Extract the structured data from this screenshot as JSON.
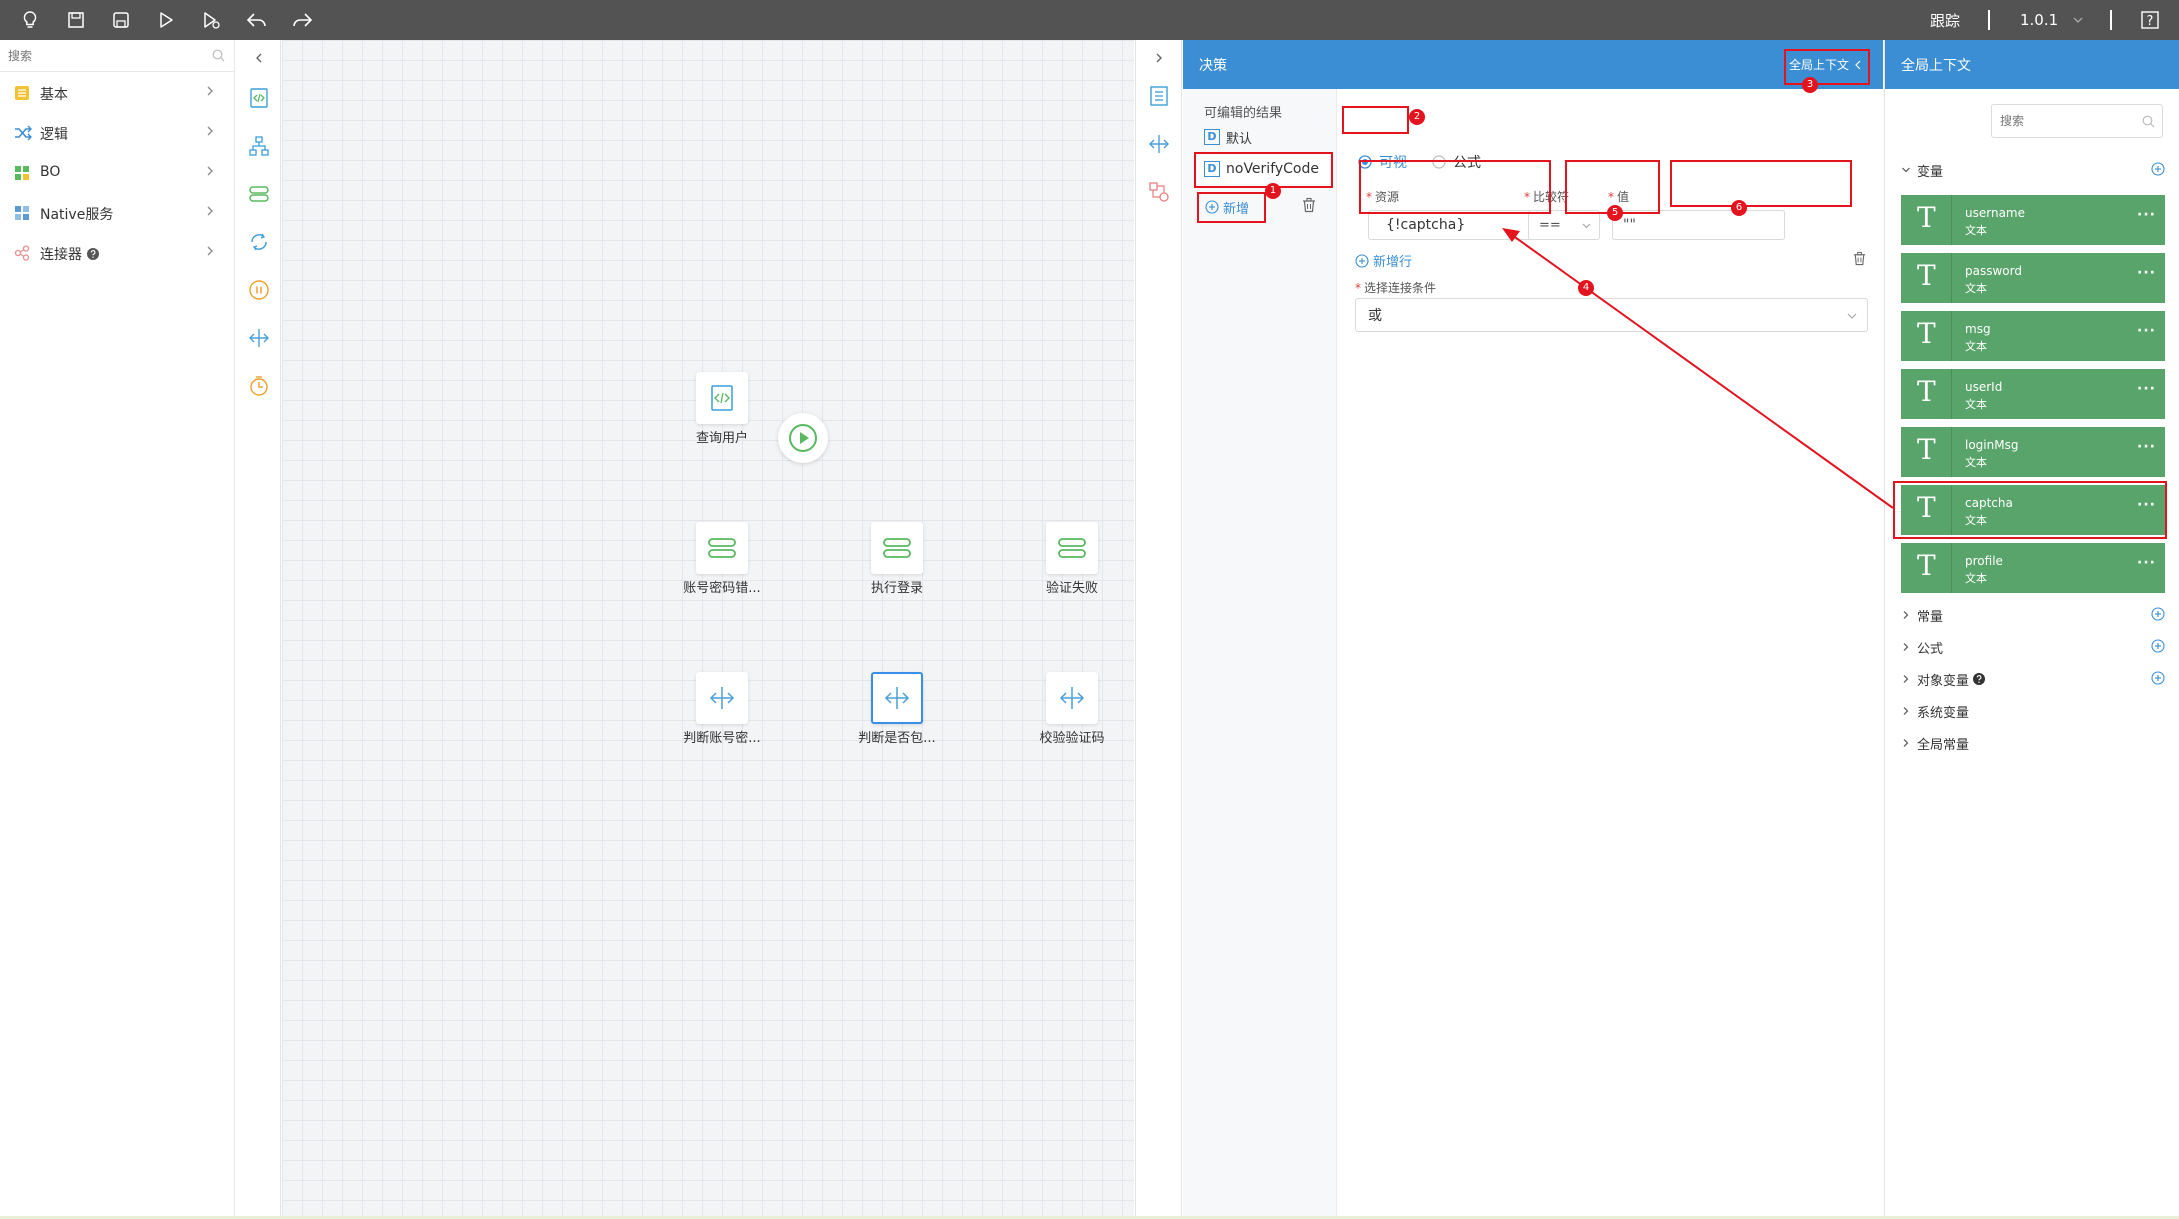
{
  "topbar": {
    "icons": [
      "lightbulb-icon",
      "save-icon",
      "save-as-icon",
      "run-icon",
      "debug-icon",
      "undo-icon",
      "redo-icon"
    ],
    "trace_label": "跟踪",
    "version": "1.0.1",
    "help": "?"
  },
  "left_panel": {
    "search_placeholder": "搜索",
    "categories": [
      {
        "label": "基本",
        "icon": "basic-icon",
        "color": "#f1c232"
      },
      {
        "label": "逻辑",
        "icon": "logic-icon",
        "color": "#3b8ed3"
      },
      {
        "label": "BO",
        "icon": "bo-icon",
        "color": "#58b95f"
      },
      {
        "label": "Native服务",
        "icon": "native-service-icon",
        "color": "#5b9bd5"
      },
      {
        "label": "连接器",
        "icon": "connector-icon",
        "color": "#e88f8f"
      }
    ]
  },
  "canvas": {
    "nodes": [
      {
        "label": "查询用户",
        "type": "script"
      },
      {
        "label": "账号密码错...",
        "type": "assign"
      },
      {
        "label": "执行登录",
        "type": "assign"
      },
      {
        "label": "验证失败",
        "type": "assign"
      },
      {
        "label": "判断账号密...",
        "type": "decision"
      },
      {
        "label": "判断是否包...",
        "type": "decision"
      },
      {
        "label": "校验验证码",
        "type": "decision"
      }
    ]
  },
  "decision_panel": {
    "title": "决策",
    "global_context_link": "全局上下文",
    "results_heading": "可编辑的结果",
    "results": [
      {
        "label": "默认",
        "tag": "D"
      },
      {
        "label": "noVerifyCode",
        "tag": "D"
      }
    ],
    "add_label": "新增",
    "mode_visual": "可视",
    "mode_formula": "公式",
    "source_label": "资源",
    "operator_label": "比较符",
    "value_label": "值",
    "source_value": "{!captcha}",
    "operator_value": "==",
    "value_value": "\"\"",
    "add_row_label": "新增行",
    "condition_label": "选择连接条件",
    "condition_value": "或"
  },
  "context_panel": {
    "title": "全局上下文",
    "search_placeholder": "搜索",
    "variables_label": "变量",
    "variables": [
      {
        "name": "username",
        "type": "文本"
      },
      {
        "name": "password",
        "type": "文本"
      },
      {
        "name": "msg",
        "type": "文本"
      },
      {
        "name": "userId",
        "type": "文本"
      },
      {
        "name": "loginMsg",
        "type": "文本"
      },
      {
        "name": "captcha",
        "type": "文本"
      },
      {
        "name": "profile",
        "type": "文本"
      }
    ],
    "sections": [
      "常量",
      "公式",
      "对象变量",
      "系统变量",
      "全局常量"
    ]
  },
  "annotations": [
    "1",
    "2",
    "3",
    "4",
    "5",
    "6"
  ],
  "colors": {
    "topbar": "#535353",
    "header_blue": "#3b8ed3",
    "variable_card": "#58a46a",
    "annotation_red": "#e3141e",
    "node_green": "#58b95f",
    "node_blue": "#4a9fd8"
  }
}
